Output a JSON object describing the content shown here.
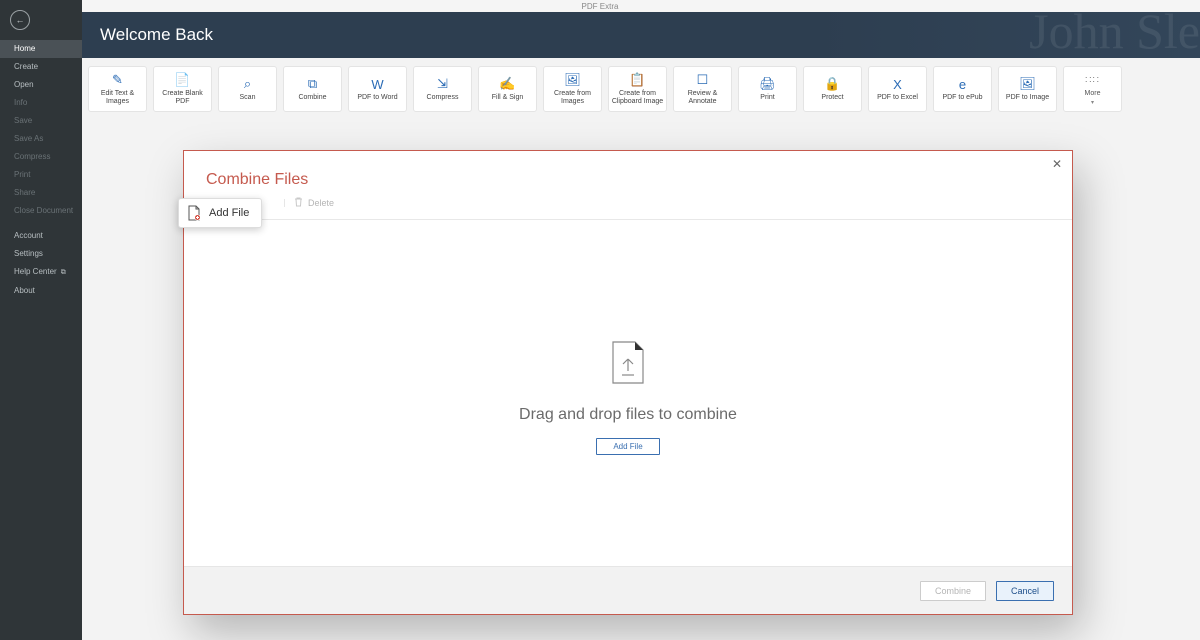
{
  "app_title": "PDF Extra",
  "sidebar": {
    "top": [
      {
        "label": "Home",
        "state": "active"
      },
      {
        "label": "Create",
        "state": ""
      },
      {
        "label": "Open",
        "state": ""
      },
      {
        "label": "Info",
        "state": "disabled"
      },
      {
        "label": "Save",
        "state": "disabled"
      },
      {
        "label": "Save As",
        "state": "disabled"
      },
      {
        "label": "Compress",
        "state": "disabled"
      },
      {
        "label": "Print",
        "state": "disabled"
      },
      {
        "label": "Share",
        "state": "disabled"
      },
      {
        "label": "Close Document",
        "state": "disabled"
      }
    ],
    "footer": [
      {
        "label": "Account"
      },
      {
        "label": "Settings"
      },
      {
        "label": "Help Center",
        "external": true
      },
      {
        "label": "About"
      }
    ]
  },
  "banner_title": "Welcome Back",
  "actions": [
    {
      "label": "Edit Text & Images"
    },
    {
      "label": "Create Blank PDF"
    },
    {
      "label": "Scan"
    },
    {
      "label": "Combine"
    },
    {
      "label": "PDF to Word"
    },
    {
      "label": "Compress"
    },
    {
      "label": "Fill & Sign"
    },
    {
      "label": "Create from Images"
    },
    {
      "label": "Create from Clipboard Image"
    },
    {
      "label": "Review & Annotate"
    },
    {
      "label": "Print"
    },
    {
      "label": "Protect"
    },
    {
      "label": "PDF to Excel"
    },
    {
      "label": "PDF to ePub"
    },
    {
      "label": "PDF to Image"
    }
  ],
  "more_label": "More",
  "modal": {
    "title": "Combine Files",
    "add_file": "Add File",
    "delete": "Delete",
    "drop_msg": "Drag and drop files to combine",
    "add_file_btn": "Add File",
    "combine_btn": "Combine",
    "cancel_btn": "Cancel"
  }
}
